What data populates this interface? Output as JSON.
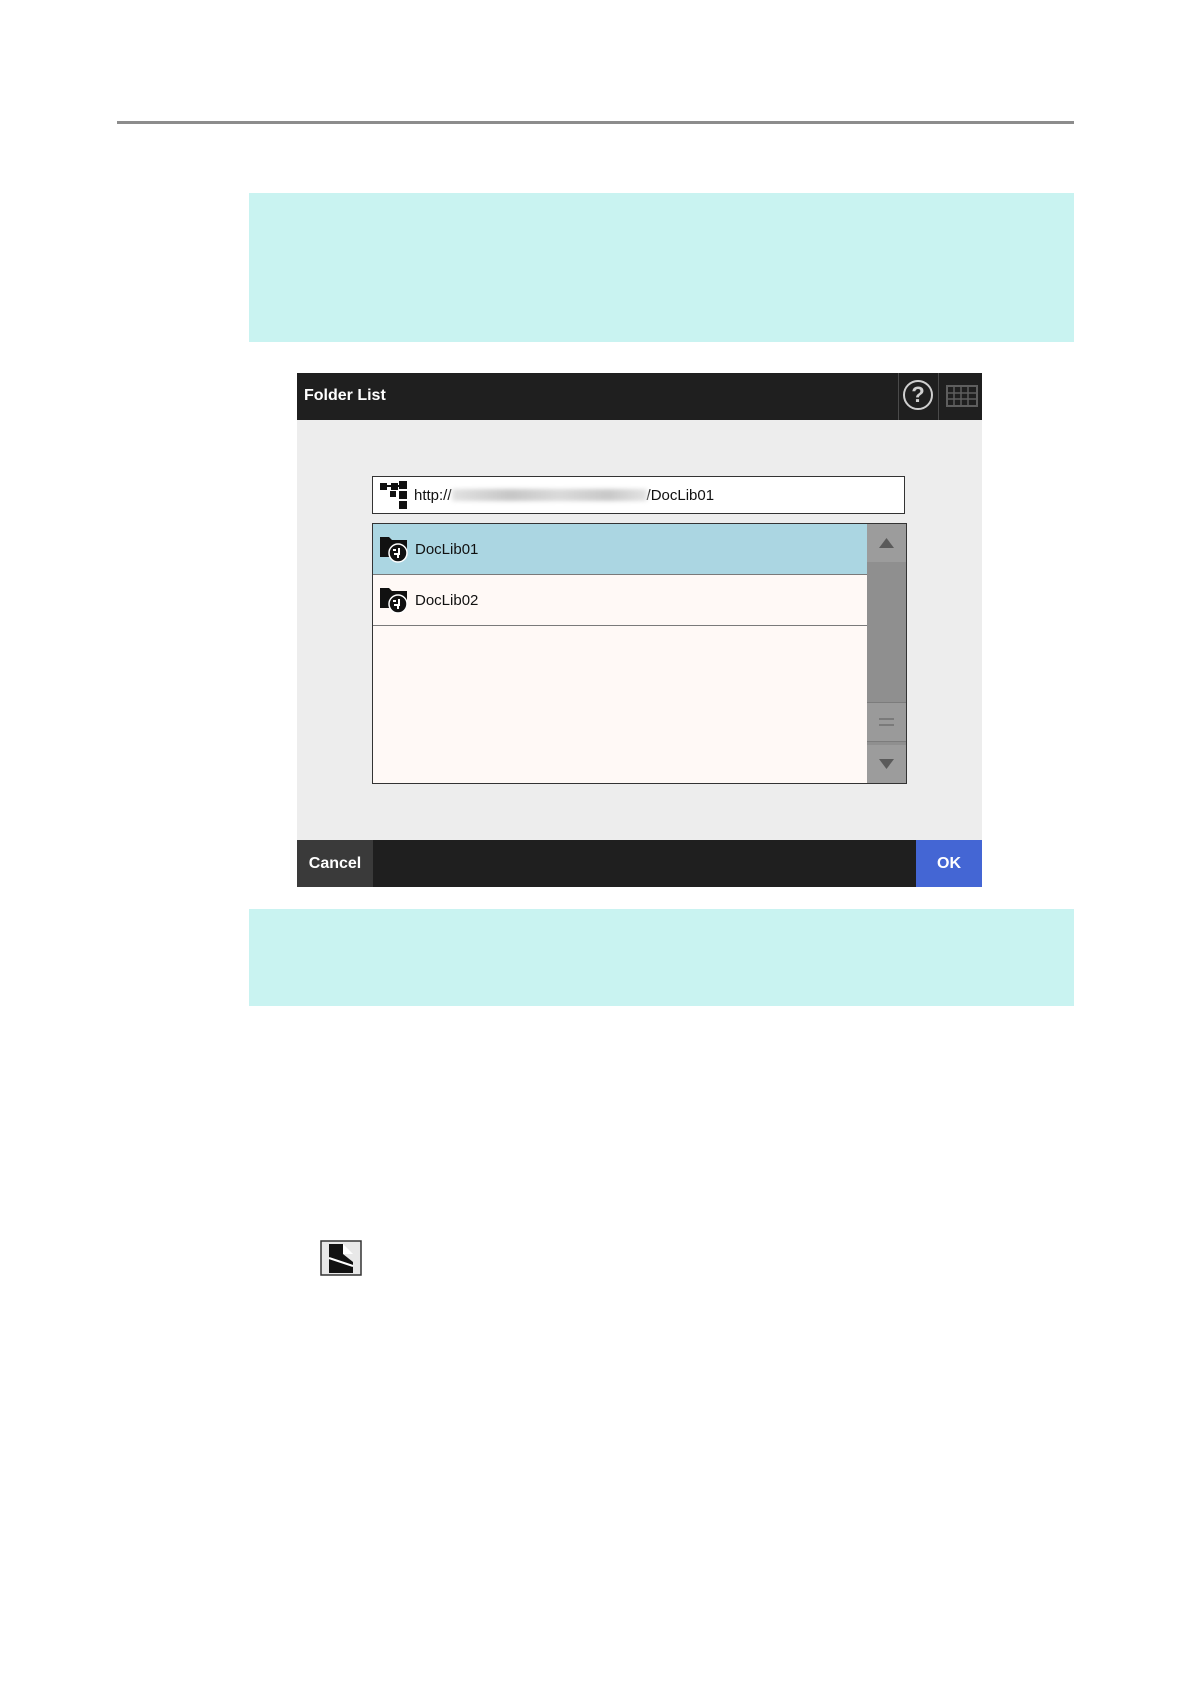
{
  "dialog": {
    "title": "Folder List",
    "help_icon_glyph": "?",
    "path": {
      "prefix": "http://",
      "suffix": "/DocLib01",
      "icon": "folder-tree-icon"
    },
    "folders": [
      {
        "label": "DocLib01",
        "selected": true,
        "icon": "sharepoint-folder-icon"
      },
      {
        "label": "DocLib02",
        "selected": false,
        "icon": "sharepoint-folder-icon"
      }
    ],
    "buttons": {
      "cancel": "Cancel",
      "ok": "OK"
    }
  },
  "colors": {
    "note_band": "#c9f3f1",
    "dialog_bar": "#1f1f1f",
    "selected_row": "#abd6e2",
    "ok_button": "#4466d4"
  }
}
